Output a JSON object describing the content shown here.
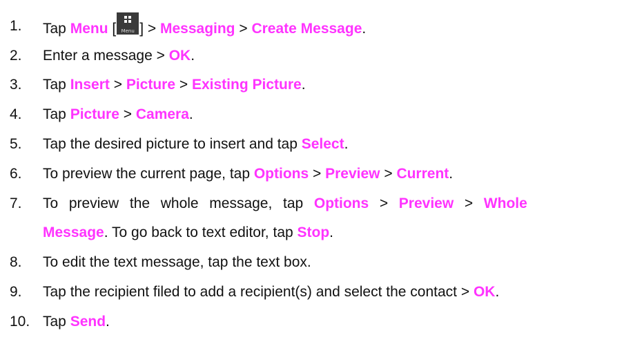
{
  "steps": [
    {
      "number": "1.",
      "parts": [
        {
          "t": "Tap "
        },
        {
          "t": "Menu",
          "hl": true
        },
        {
          "t": " ["
        },
        {
          "icon": "menu-icon",
          "label": "Menu"
        },
        {
          "t": "] > "
        },
        {
          "t": "Messaging",
          "hl": true
        },
        {
          "t": " > "
        },
        {
          "t": "Create Message",
          "hl": true
        },
        {
          "t": "."
        }
      ]
    },
    {
      "number": "2.",
      "parts": [
        {
          "t": "Enter a message > "
        },
        {
          "t": "OK",
          "hl": true
        },
        {
          "t": "."
        }
      ]
    },
    {
      "number": "3.",
      "parts": [
        {
          "t": "Tap "
        },
        {
          "t": "Insert",
          "hl": true
        },
        {
          "t": " > "
        },
        {
          "t": "Picture",
          "hl": true
        },
        {
          "t": " > "
        },
        {
          "t": "Existing Picture",
          "hl": true
        },
        {
          "t": "."
        }
      ]
    },
    {
      "number": "4.",
      "parts": [
        {
          "t": "Tap "
        },
        {
          "t": "Picture",
          "hl": true
        },
        {
          "t": " > "
        },
        {
          "t": "Camera",
          "hl": true
        },
        {
          "t": "."
        }
      ]
    },
    {
      "number": "5.",
      "parts": [
        {
          "t": "Tap the desired picture to insert and tap "
        },
        {
          "t": "Select",
          "hl": true
        },
        {
          "t": "."
        }
      ]
    },
    {
      "number": "6.",
      "parts": [
        {
          "t": "To preview the current page, tap "
        },
        {
          "t": "Options",
          "hl": true
        },
        {
          "t": " > "
        },
        {
          "t": "Preview",
          "hl": true
        },
        {
          "t": " > "
        },
        {
          "t": "Current",
          "hl": true
        },
        {
          "t": "."
        }
      ]
    },
    {
      "number": "7.",
      "parts": [
        {
          "t": "To  preview  the  whole  message,  tap  "
        },
        {
          "t": "Options",
          "hl": true
        },
        {
          "t": "  >  "
        },
        {
          "t": "Preview",
          "hl": true
        },
        {
          "t": "  >  "
        },
        {
          "t": "Whole",
          "hl": true
        }
      ]
    },
    {
      "number": "",
      "parts": [
        {
          "t": "Message",
          "hl": true
        },
        {
          "t": ". To go back to text editor, tap "
        },
        {
          "t": "Stop",
          "hl": true
        },
        {
          "t": "."
        }
      ]
    },
    {
      "number": "8.",
      "parts": [
        {
          "t": "To edit the text message, tap the text box."
        }
      ]
    },
    {
      "number": "9.",
      "parts": [
        {
          "t": "Tap the recipient filed to add a recipient(s) and select the contact > "
        },
        {
          "t": "OK",
          "hl": true
        },
        {
          "t": "."
        }
      ]
    },
    {
      "number": "10.",
      "parts": [
        {
          "t": "Tap "
        },
        {
          "t": "Send",
          "hl": true
        },
        {
          "t": "."
        }
      ]
    }
  ],
  "colors": {
    "highlight": "#ff33ff",
    "text": "#111111",
    "icon_bg": "#3a3a3a"
  }
}
